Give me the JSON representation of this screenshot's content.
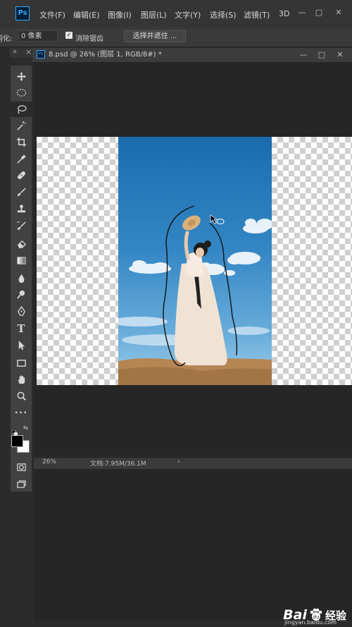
{
  "app": {
    "logo_text": "Ps"
  },
  "menu": {
    "items": [
      {
        "label": "文件(F)"
      },
      {
        "label": "编辑(E)"
      },
      {
        "label": "图像(I)"
      },
      {
        "label": "图层(L)"
      },
      {
        "label": "文字(Y)"
      },
      {
        "label": "选择(S)"
      },
      {
        "label": "滤镜(T)"
      },
      {
        "label": "3D"
      }
    ]
  },
  "window_controls": {
    "minimize": "—",
    "restore": "□",
    "close": "✕"
  },
  "options_bar": {
    "feather_label": "羽化:",
    "feather_value": "0 像素",
    "antialias_label": "消除锯齿",
    "antialias_checked": true,
    "select_mask_label": "选择并遮住 ..."
  },
  "panel_header": {
    "collapse": "»",
    "close": "×"
  },
  "tools": [
    {
      "name": "move-tool",
      "icon": "move-icon"
    },
    {
      "name": "marquee-tool",
      "icon": "ellipse-marquee-icon"
    },
    {
      "name": "lasso-tool",
      "icon": "lasso-icon",
      "active": true
    },
    {
      "name": "magic-wand-tool",
      "icon": "magic-wand-icon"
    },
    {
      "name": "crop-tool",
      "icon": "crop-icon"
    },
    {
      "name": "eyedropper-tool",
      "icon": "eyedropper-icon"
    },
    {
      "name": "healing-tool",
      "icon": "bandage-icon"
    },
    {
      "name": "brush-tool",
      "icon": "brush-icon"
    },
    {
      "name": "stamp-tool",
      "icon": "stamp-icon"
    },
    {
      "name": "history-brush-tool",
      "icon": "history-brush-icon"
    },
    {
      "name": "eraser-tool",
      "icon": "eraser-icon"
    },
    {
      "name": "gradient-tool",
      "icon": "gradient-icon"
    },
    {
      "name": "blur-tool",
      "icon": "drop-icon"
    },
    {
      "name": "dodge-tool",
      "icon": "dodge-icon"
    },
    {
      "name": "pen-tool",
      "icon": "pen-icon"
    },
    {
      "name": "type-tool",
      "icon": "type-icon"
    },
    {
      "name": "path-select-tool",
      "icon": "arrow-icon"
    },
    {
      "name": "shape-tool",
      "icon": "rectangle-icon"
    },
    {
      "name": "hand-tool",
      "icon": "hand-icon"
    },
    {
      "name": "zoom-tool",
      "icon": "zoom-icon"
    },
    {
      "name": "more-tools",
      "icon": "ellipsis-icon"
    }
  ],
  "type_tool_glyph": "T",
  "more_tools_glyph": "•••",
  "colors": {
    "foreground": "#000000",
    "background": "#ffffff",
    "accent": "#31a8ff"
  },
  "document": {
    "tab_title": "8.psd @ 26% (图层 1, RGB/8#) *",
    "tab_icon_text": "Ps"
  },
  "doc_controls": {
    "minimize": "—",
    "restore": "□",
    "close": "✕"
  },
  "status": {
    "zoom": "26%",
    "doc_size": "文档:7.95M/36.1M",
    "arrow": "›"
  },
  "watermark": {
    "brand_left": "Bai",
    "brand_right": "du",
    "product": "经验",
    "domain": "jingyan.baidu.com"
  }
}
